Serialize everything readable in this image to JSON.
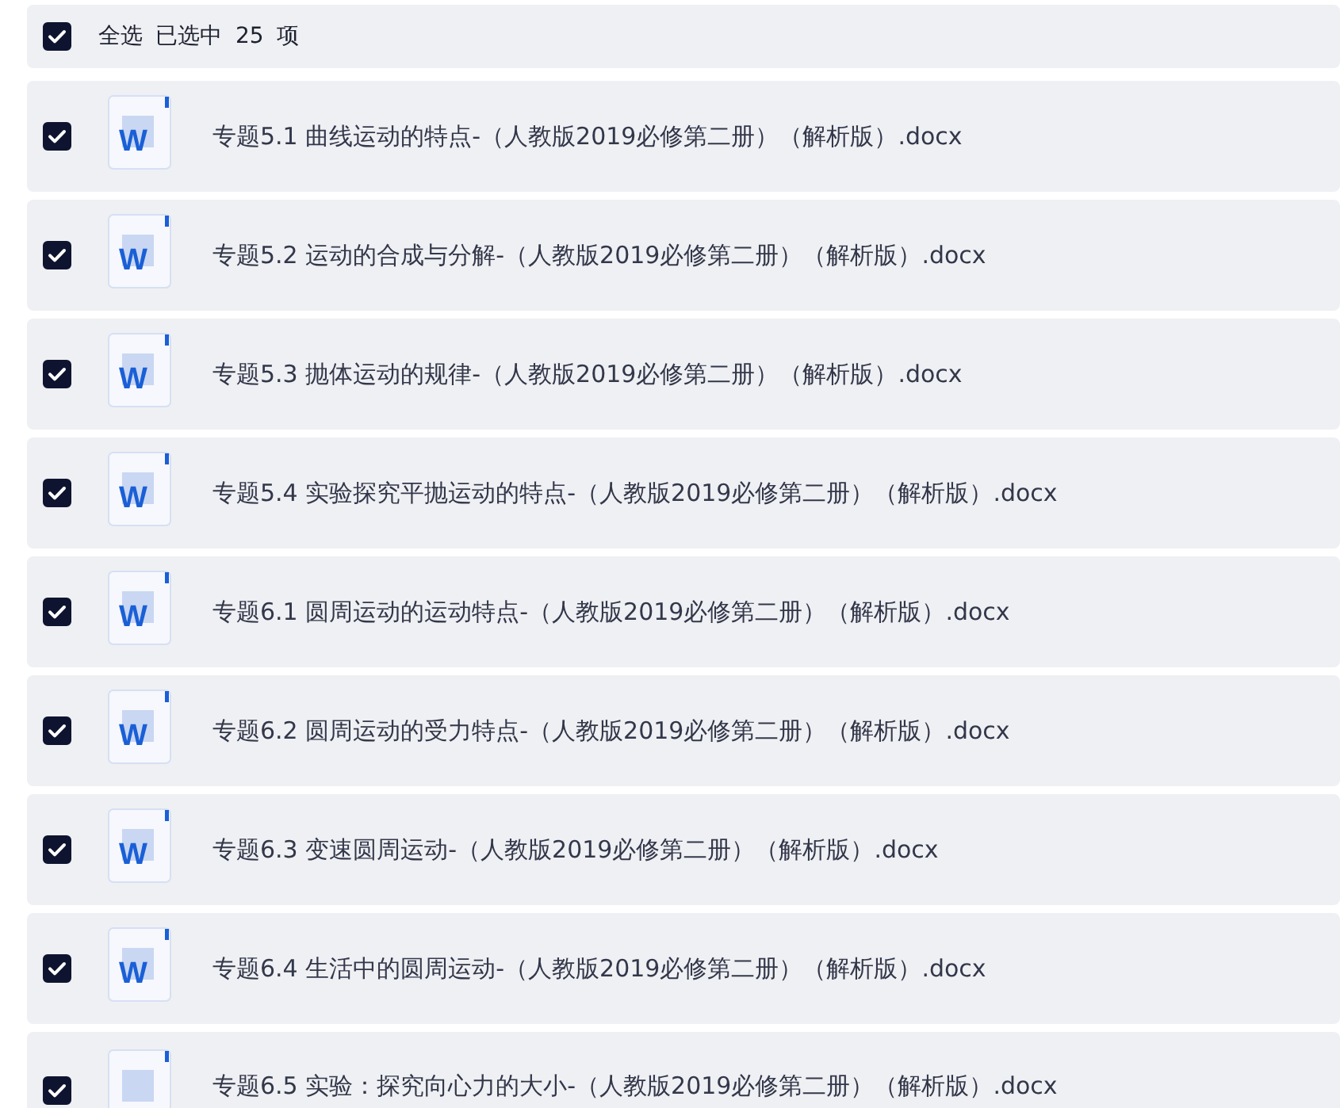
{
  "header": {
    "checked": true,
    "select_all_label": "全选",
    "selected_count": "已选中 25 项"
  },
  "files": [
    {
      "checked": true,
      "icon_letter": "W",
      "name": "专题5.1 曲线运动的特点-（人教版2019必修第二册）（解析版）.docx"
    },
    {
      "checked": true,
      "icon_letter": "W",
      "name": "专题5.2 运动的合成与分解-（人教版2019必修第二册）（解析版）.docx"
    },
    {
      "checked": true,
      "icon_letter": "W",
      "name": "专题5.3 抛体运动的规律-（人教版2019必修第二册）（解析版）.docx"
    },
    {
      "checked": true,
      "icon_letter": "W",
      "name": "专题5.4 实验探究平抛运动的特点-（人教版2019必修第二册）（解析版）.docx"
    },
    {
      "checked": true,
      "icon_letter": "W",
      "name": "专题6.1 圆周运动的运动特点-（人教版2019必修第二册）（解析版）.docx"
    },
    {
      "checked": true,
      "icon_letter": "W",
      "name": "专题6.2 圆周运动的受力特点-（人教版2019必修第二册）（解析版）.docx"
    },
    {
      "checked": true,
      "icon_letter": "W",
      "name": "专题6.3 变速圆周运动-（人教版2019必修第二册）（解析版）.docx"
    },
    {
      "checked": true,
      "icon_letter": "W",
      "name": "专题6.4 生活中的圆周运动-（人教版2019必修第二册）（解析版）.docx"
    },
    {
      "checked": true,
      "name": "专题6.5 实验：探究向心力的大小-（人教版2019必修第二册）（解析版）.docx"
    }
  ]
}
